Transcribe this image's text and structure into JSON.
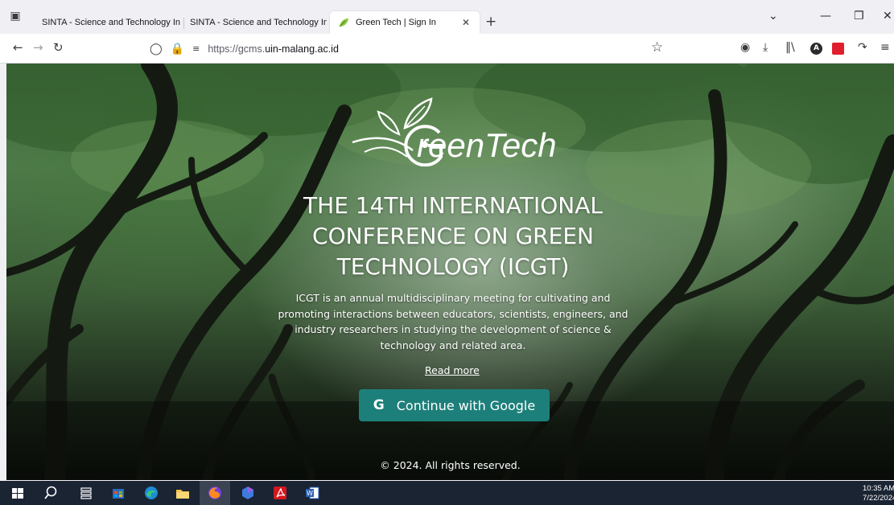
{
  "browser": {
    "tabs": [
      {
        "label": "SINTA - Science and Technology Ind",
        "fade": "ex"
      },
      {
        "label": "SINTA - Science and Technology Ind",
        "fade": "ex"
      },
      {
        "label": "Green Tech | Sign In",
        "active": true
      }
    ],
    "url_prefix": "https://gcms.",
    "url_domain": "uin-malang.ac.id"
  },
  "page": {
    "logo_text": "reenTech",
    "headline": "THE 14TH INTERNATIONAL CONFERENCE ON GREEN TECHNOLOGY (ICGT)",
    "description": "ICGT is an annual multidisciplinary meeting for cultivating and promoting interactions between educators, scientists, engineers, and industry researchers in studying the development of science & technology and related area.",
    "read_more": "Read more",
    "google_button": "Continue with Google",
    "google_glyph": "G",
    "footer": "© 2024. All rights reserved."
  },
  "taskbar": {
    "time": "10:35 AM",
    "date": "7/22/2024"
  },
  "colors": {
    "button": "#1d7f7a",
    "taskbar": "#1a2433"
  }
}
